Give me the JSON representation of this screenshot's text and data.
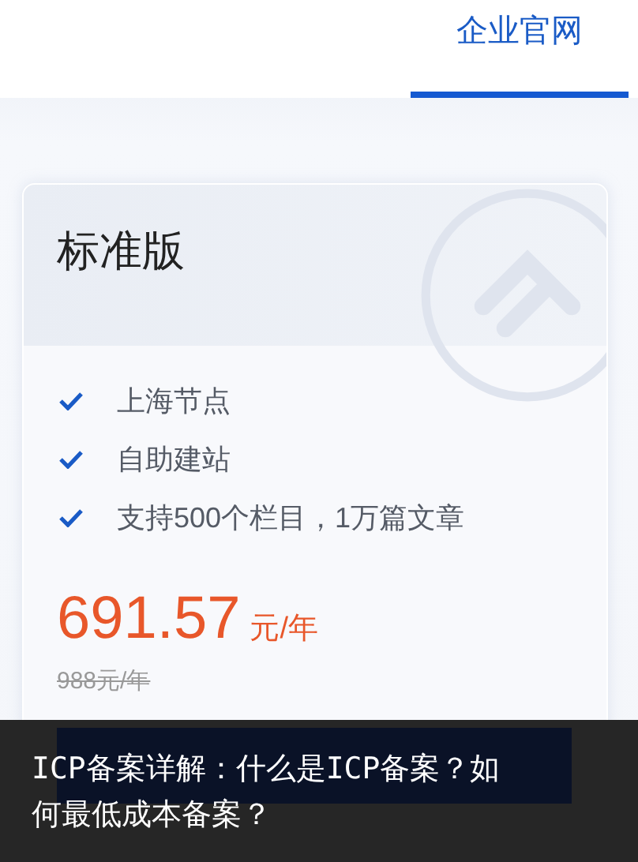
{
  "nav": {
    "tabs": [
      {
        "label": "企业官网",
        "selected": true
      }
    ]
  },
  "plan": {
    "title": "标准版",
    "features": [
      {
        "text": "上海节点"
      },
      {
        "text": "自助建站"
      },
      {
        "text": "支持500个栏目，1万篇文章"
      }
    ],
    "price": "691.57",
    "price_unit": "元/年",
    "original_price": "988元/年"
  },
  "caption": "ICP备案详解：什么是ICP备案？如何最低成本备案？"
}
